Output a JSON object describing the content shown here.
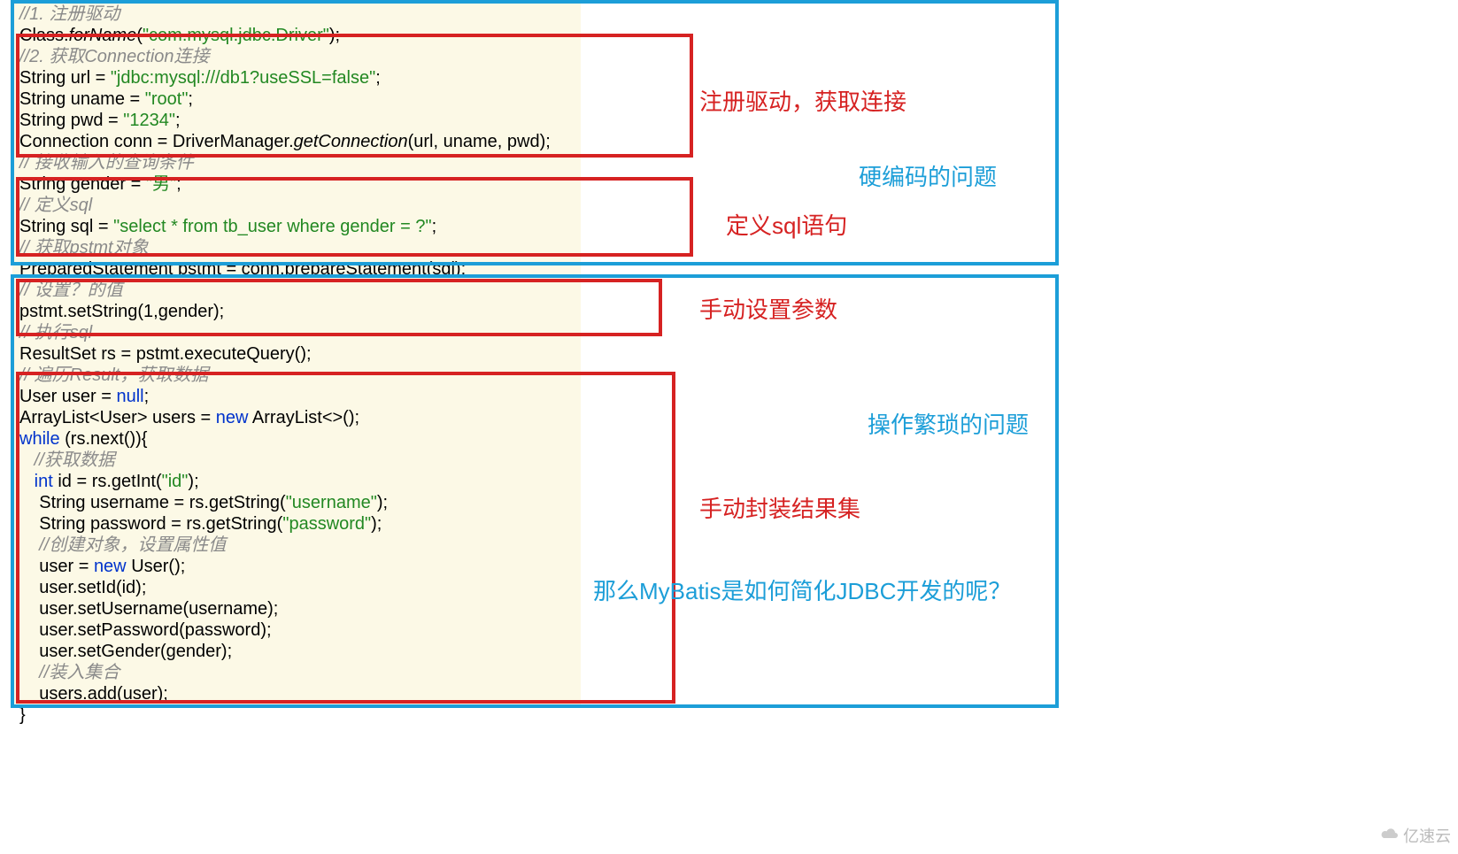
{
  "code": {
    "l01": "//1. 注册驱动",
    "l02a": "Class.",
    "l02b": "forName",
    "l02c": "(",
    "l02d": "\"com.mysql.jdbc.Driver\"",
    "l02e": ");",
    "l03": "//2. 获取Connection连接",
    "l04a": "String url = ",
    "l04b": "\"jdbc:mysql:///db1?useSSL=false\"",
    "l04c": ";",
    "l05a": "String uname = ",
    "l05b": "\"root\"",
    "l05c": ";",
    "l06a": "String pwd = ",
    "l06b": "\"1234\"",
    "l06c": ";",
    "l07a": "Connection conn = DriverManager.",
    "l07b": "getConnection",
    "l07c": "(url, uname, pwd);",
    "l08": "// 接收输入的查询条件",
    "l09a": "String gender = ",
    "l09b": "\"男\"",
    "l09c": ";",
    "l10": "// 定义sql",
    "l11a": "String sql = ",
    "l11b": "\"select * from tb_user where gender = ?\"",
    "l11c": ";",
    "l12": "// 获取pstmt对象",
    "l13": "PreparedStatement pstmt = conn.prepareStatement(sql);",
    "l14": "// 设置？的值",
    "l15": "pstmt.setString(1,gender);",
    "l16": "// 执行sql",
    "l17": "ResultSet rs = pstmt.executeQuery();",
    "l18": "// 遍历Result，获取数据",
    "l19a": "User user = ",
    "l19b": "null",
    "l19c": ";",
    "l20a": "ArrayList<User> users = ",
    "l20b": "new",
    "l20c": " ArrayList<>();",
    "l21a": "while",
    "l21b": " (rs.next()){",
    "l22": "   //获取数据",
    "l23a": "   int",
    "l23b": " id = rs.getInt(",
    "l23c": "\"id\"",
    "l23d": ");",
    "l24a": "    String username = rs.getString(",
    "l24b": "\"username\"",
    "l24c": ");",
    "l25a": "    String password = rs.getString(",
    "l25b": "\"password\"",
    "l25c": ");",
    "l26": "    //创建对象，设置属性值",
    "l27a": "    user = ",
    "l27b": "new",
    "l27c": " User();",
    "l28": "    user.setId(id);",
    "l29": "    user.setUsername(username);",
    "l30": "    user.setPassword(password);",
    "l31": "    user.setGender(gender);",
    "l32": "    //装入集合",
    "l33": "    users.add(user);",
    "l34": "}"
  },
  "labels": {
    "register": "注册驱动，获取连接",
    "hardcode": "硬编码的问题",
    "defineSql": "定义sql语句",
    "setParam": "手动设置参数",
    "cumbersome": "操作繁琐的问题",
    "wrapResult": "手动封装结果集",
    "question": "那么MyBatis是如何简化JDBC开发的呢？"
  },
  "watermark": "亿速云"
}
